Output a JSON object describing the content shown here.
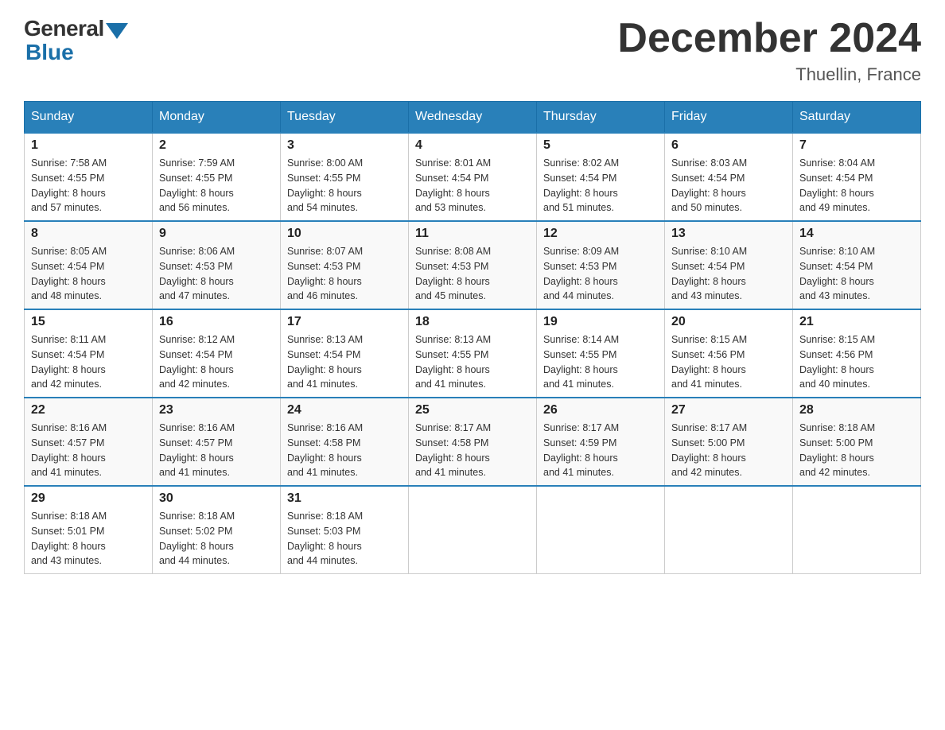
{
  "header": {
    "logo_general": "General",
    "logo_blue": "Blue",
    "title": "December 2024",
    "subtitle": "Thuellin, France"
  },
  "days_of_week": [
    "Sunday",
    "Monday",
    "Tuesday",
    "Wednesday",
    "Thursday",
    "Friday",
    "Saturday"
  ],
  "weeks": [
    [
      {
        "day": "1",
        "sunrise": "7:58 AM",
        "sunset": "4:55 PM",
        "daylight": "8 hours and 57 minutes."
      },
      {
        "day": "2",
        "sunrise": "7:59 AM",
        "sunset": "4:55 PM",
        "daylight": "8 hours and 56 minutes."
      },
      {
        "day": "3",
        "sunrise": "8:00 AM",
        "sunset": "4:55 PM",
        "daylight": "8 hours and 54 minutes."
      },
      {
        "day": "4",
        "sunrise": "8:01 AM",
        "sunset": "4:54 PM",
        "daylight": "8 hours and 53 minutes."
      },
      {
        "day": "5",
        "sunrise": "8:02 AM",
        "sunset": "4:54 PM",
        "daylight": "8 hours and 51 minutes."
      },
      {
        "day": "6",
        "sunrise": "8:03 AM",
        "sunset": "4:54 PM",
        "daylight": "8 hours and 50 minutes."
      },
      {
        "day": "7",
        "sunrise": "8:04 AM",
        "sunset": "4:54 PM",
        "daylight": "8 hours and 49 minutes."
      }
    ],
    [
      {
        "day": "8",
        "sunrise": "8:05 AM",
        "sunset": "4:54 PM",
        "daylight": "8 hours and 48 minutes."
      },
      {
        "day": "9",
        "sunrise": "8:06 AM",
        "sunset": "4:53 PM",
        "daylight": "8 hours and 47 minutes."
      },
      {
        "day": "10",
        "sunrise": "8:07 AM",
        "sunset": "4:53 PM",
        "daylight": "8 hours and 46 minutes."
      },
      {
        "day": "11",
        "sunrise": "8:08 AM",
        "sunset": "4:53 PM",
        "daylight": "8 hours and 45 minutes."
      },
      {
        "day": "12",
        "sunrise": "8:09 AM",
        "sunset": "4:53 PM",
        "daylight": "8 hours and 44 minutes."
      },
      {
        "day": "13",
        "sunrise": "8:10 AM",
        "sunset": "4:54 PM",
        "daylight": "8 hours and 43 minutes."
      },
      {
        "day": "14",
        "sunrise": "8:10 AM",
        "sunset": "4:54 PM",
        "daylight": "8 hours and 43 minutes."
      }
    ],
    [
      {
        "day": "15",
        "sunrise": "8:11 AM",
        "sunset": "4:54 PM",
        "daylight": "8 hours and 42 minutes."
      },
      {
        "day": "16",
        "sunrise": "8:12 AM",
        "sunset": "4:54 PM",
        "daylight": "8 hours and 42 minutes."
      },
      {
        "day": "17",
        "sunrise": "8:13 AM",
        "sunset": "4:54 PM",
        "daylight": "8 hours and 41 minutes."
      },
      {
        "day": "18",
        "sunrise": "8:13 AM",
        "sunset": "4:55 PM",
        "daylight": "8 hours and 41 minutes."
      },
      {
        "day": "19",
        "sunrise": "8:14 AM",
        "sunset": "4:55 PM",
        "daylight": "8 hours and 41 minutes."
      },
      {
        "day": "20",
        "sunrise": "8:15 AM",
        "sunset": "4:56 PM",
        "daylight": "8 hours and 41 minutes."
      },
      {
        "day": "21",
        "sunrise": "8:15 AM",
        "sunset": "4:56 PM",
        "daylight": "8 hours and 40 minutes."
      }
    ],
    [
      {
        "day": "22",
        "sunrise": "8:16 AM",
        "sunset": "4:57 PM",
        "daylight": "8 hours and 41 minutes."
      },
      {
        "day": "23",
        "sunrise": "8:16 AM",
        "sunset": "4:57 PM",
        "daylight": "8 hours and 41 minutes."
      },
      {
        "day": "24",
        "sunrise": "8:16 AM",
        "sunset": "4:58 PM",
        "daylight": "8 hours and 41 minutes."
      },
      {
        "day": "25",
        "sunrise": "8:17 AM",
        "sunset": "4:58 PM",
        "daylight": "8 hours and 41 minutes."
      },
      {
        "day": "26",
        "sunrise": "8:17 AM",
        "sunset": "4:59 PM",
        "daylight": "8 hours and 41 minutes."
      },
      {
        "day": "27",
        "sunrise": "8:17 AM",
        "sunset": "5:00 PM",
        "daylight": "8 hours and 42 minutes."
      },
      {
        "day": "28",
        "sunrise": "8:18 AM",
        "sunset": "5:00 PM",
        "daylight": "8 hours and 42 minutes."
      }
    ],
    [
      {
        "day": "29",
        "sunrise": "8:18 AM",
        "sunset": "5:01 PM",
        "daylight": "8 hours and 43 minutes."
      },
      {
        "day": "30",
        "sunrise": "8:18 AM",
        "sunset": "5:02 PM",
        "daylight": "8 hours and 44 minutes."
      },
      {
        "day": "31",
        "sunrise": "8:18 AM",
        "sunset": "5:03 PM",
        "daylight": "8 hours and 44 minutes."
      },
      null,
      null,
      null,
      null
    ]
  ],
  "labels": {
    "sunrise": "Sunrise:",
    "sunset": "Sunset:",
    "daylight": "Daylight:"
  }
}
